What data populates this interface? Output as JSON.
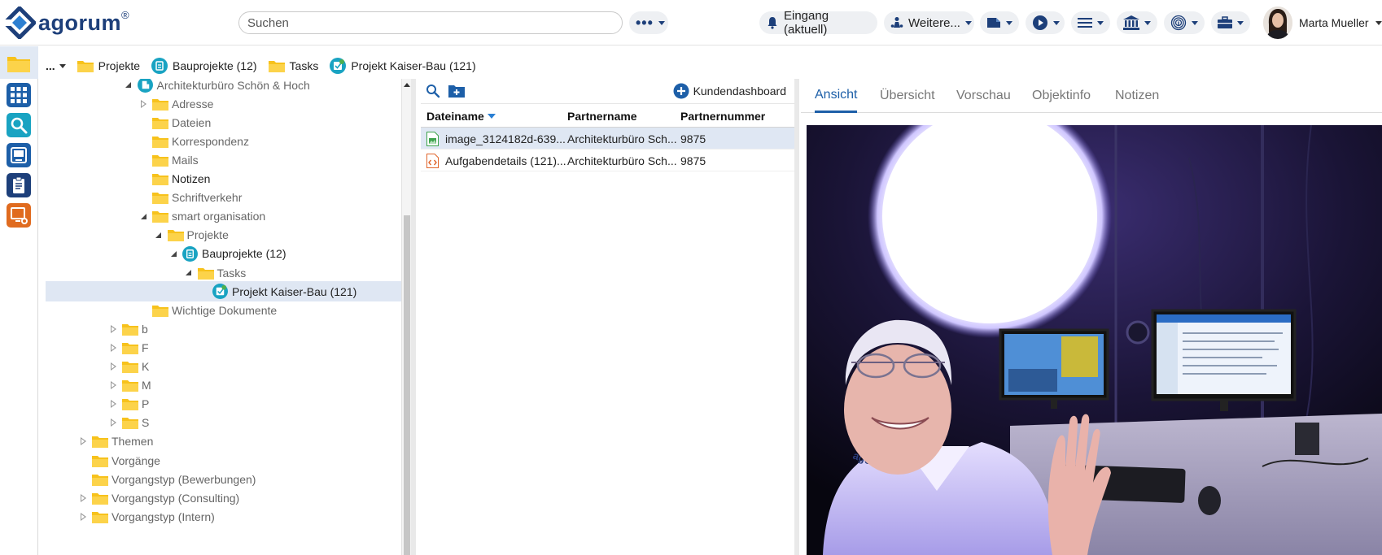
{
  "app": {
    "logo_text": "agorum"
  },
  "header": {
    "search_placeholder": "Suchen",
    "inbox_label": "Eingang (aktuell)",
    "more_label": "Weitere...",
    "user_name": "Marta Mueller"
  },
  "breadcrumb": {
    "overflow": "...",
    "items": [
      {
        "label": "Projekte",
        "icon": "folder-icon"
      },
      {
        "label": "Bauprojekte (12)",
        "icon": "project-icon"
      },
      {
        "label": "Tasks",
        "icon": "folder-icon"
      },
      {
        "label": "Projekt Kaiser-Bau (121)",
        "icon": "task-icon"
      }
    ]
  },
  "tree": {
    "items": [
      {
        "label": "Architekturbüro Schön & Hoch",
        "level": 5,
        "toggle": "open",
        "icon": "company-icon"
      },
      {
        "label": "Adresse",
        "level": 6,
        "toggle": "closed",
        "icon": "folder-icon"
      },
      {
        "label": "Dateien",
        "level": 6,
        "toggle": "none",
        "icon": "folder-icon"
      },
      {
        "label": "Korrespondenz",
        "level": 6,
        "toggle": "none",
        "icon": "folder-icon"
      },
      {
        "label": "Mails",
        "level": 6,
        "toggle": "none",
        "icon": "folder-icon"
      },
      {
        "label": "Notizen",
        "level": 6,
        "toggle": "none",
        "icon": "folder-icon",
        "dark": true
      },
      {
        "label": "Schriftverkehr",
        "level": 6,
        "toggle": "none",
        "icon": "folder-icon"
      },
      {
        "label": "smart organisation",
        "level": 6,
        "toggle": "open",
        "icon": "folder-icon"
      },
      {
        "label": "Projekte",
        "level": 7,
        "toggle": "open",
        "icon": "folder-icon"
      },
      {
        "label": "Bauprojekte (12)",
        "level": 8,
        "toggle": "open",
        "icon": "project-icon",
        "dark": true
      },
      {
        "label": "Tasks",
        "level": 9,
        "toggle": "open",
        "icon": "folder-icon"
      },
      {
        "label": "Projekt Kaiser-Bau (121)",
        "level": 10,
        "toggle": "none",
        "icon": "task-icon",
        "dark": true,
        "selected": true
      },
      {
        "label": "Wichtige Dokumente",
        "level": 6,
        "toggle": "none",
        "icon": "folder-icon"
      },
      {
        "label": "b",
        "level": 4,
        "toggle": "closed",
        "icon": "folder-icon"
      },
      {
        "label": "F",
        "level": 4,
        "toggle": "closed",
        "icon": "folder-icon"
      },
      {
        "label": "K",
        "level": 4,
        "toggle": "closed",
        "icon": "folder-icon"
      },
      {
        "label": "M",
        "level": 4,
        "toggle": "closed",
        "icon": "folder-icon"
      },
      {
        "label": "P",
        "level": 4,
        "toggle": "closed",
        "icon": "folder-icon"
      },
      {
        "label": "S",
        "level": 4,
        "toggle": "closed",
        "icon": "folder-icon"
      },
      {
        "label": "Themen",
        "level": 2,
        "toggle": "closed",
        "icon": "folder-icon"
      },
      {
        "label": "Vorgänge",
        "level": 2,
        "toggle": "none",
        "icon": "folder-icon"
      },
      {
        "label": "Vorgangstyp (Bewerbungen)",
        "level": 2,
        "toggle": "none",
        "icon": "folder-icon"
      },
      {
        "label": "Vorgangstyp (Consulting)",
        "level": 2,
        "toggle": "closed",
        "icon": "folder-icon"
      },
      {
        "label": "Vorgangstyp (Intern)",
        "level": 2,
        "toggle": "closed",
        "icon": "folder-icon"
      }
    ]
  },
  "filelist": {
    "dashboard_label": "Kundendashboard",
    "columns": [
      "Dateiname",
      "Partnername",
      "Partnernummer"
    ],
    "rows": [
      {
        "name": "image_3124182d-639...",
        "partner": "Architekturbüro Sch...",
        "number": "9875",
        "icon": "image-file-icon",
        "selected": true
      },
      {
        "name": "Aufgabendetails (121)...",
        "partner": "Architekturbüro Sch...",
        "number": "9875",
        "icon": "code-file-icon",
        "selected": false
      }
    ]
  },
  "preview": {
    "tabs": [
      "Ansicht",
      "Übersicht",
      "Vorschau",
      "Objektinfo",
      "Notizen"
    ],
    "active_tab": "Ansicht",
    "shirt_logo": "agorum"
  },
  "colors": {
    "brand": "#1d3f7a",
    "accent": "#1d5fa8",
    "folder": "#f7c21c",
    "teal": "#19a3c2",
    "selection": "#dfe7f3"
  }
}
